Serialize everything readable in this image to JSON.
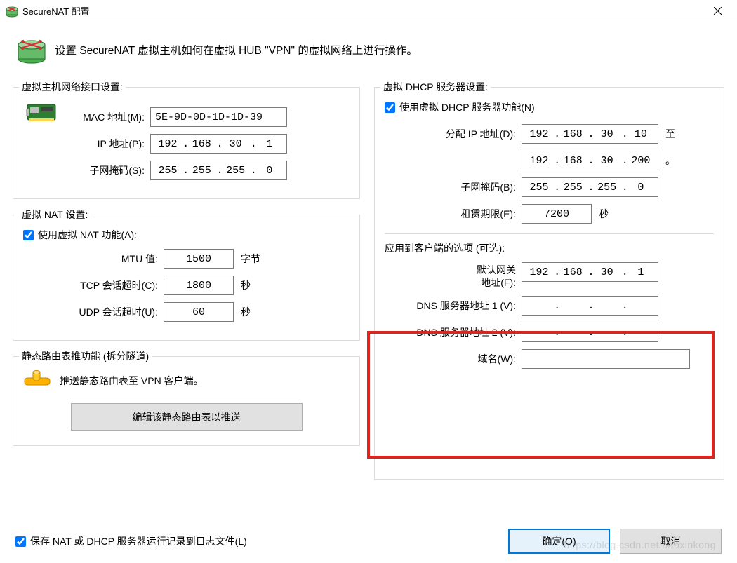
{
  "window": {
    "title": "SecureNAT 配置",
    "description": "设置 SecureNAT 虚拟主机如何在虚拟 HUB \"VPN\" 的虚拟网络上进行操作。"
  },
  "host_interface": {
    "legend": "虚拟主机网络接口设置:",
    "mac_label": "MAC 地址(M):",
    "mac_value": "5E-9D-0D-1D-1D-39",
    "ip_label": "IP 地址(P):",
    "ip_octets": [
      "192",
      "168",
      "30",
      "1"
    ],
    "mask_label": "子网掩码(S):",
    "mask_octets": [
      "255",
      "255",
      "255",
      "0"
    ]
  },
  "nat": {
    "legend": "虚拟 NAT 设置:",
    "enable_label": "使用虚拟 NAT 功能(A):",
    "enable_checked": true,
    "mtu_label": "MTU 值:",
    "mtu_value": "1500",
    "mtu_unit": "字节",
    "tcp_label": "TCP 会话超时(C):",
    "tcp_value": "1800",
    "tcp_unit": "秒",
    "udp_label": "UDP 会话超时(U):",
    "udp_value": "60",
    "udp_unit": "秒"
  },
  "static_route": {
    "legend": "静态路由表推功能 (拆分隧道)",
    "desc": "推送静态路由表至 VPN 客户端。",
    "button": "编辑该静态路由表以推送"
  },
  "dhcp": {
    "legend": "虚拟 DHCP 服务器设置:",
    "enable_label": "使用虚拟 DHCP 服务器功能(N)",
    "enable_checked": true,
    "assign_label": "分配 IP 地址(D):",
    "range_start": [
      "192",
      "168",
      "30",
      "10"
    ],
    "range_to": "至",
    "range_end": [
      "192",
      "168",
      "30",
      "200"
    ],
    "range_period": "。",
    "mask_label": "子网掩码(B):",
    "mask_octets": [
      "255",
      "255",
      "255",
      "0"
    ],
    "lease_label": "租赁期限(E):",
    "lease_value": "7200",
    "lease_unit": "秒",
    "client_opts_heading": "应用到客户端的选项 (可选):",
    "gateway_label1": "默认网关",
    "gateway_label2": "地址(F):",
    "gateway_octets": [
      "192",
      "168",
      "30",
      "1"
    ],
    "dns1_label": "DNS 服务器地址 1 (V):",
    "dns1_octets": [
      "",
      "",
      "",
      ""
    ],
    "dns2_label": "DNS 服务器地址 2 (V):",
    "dns2_octets": [
      "",
      "",
      "",
      ""
    ],
    "domain_label": "域名(W):",
    "domain_value": ""
  },
  "save_log": {
    "checked": true,
    "label": "保存 NAT 或 DHCP 服务器运行记录到日志文件(L)"
  },
  "buttons": {
    "ok": "确定(O)",
    "cancel": "取消"
  },
  "watermark": "https://blog.csdn.net/hanxinkong"
}
